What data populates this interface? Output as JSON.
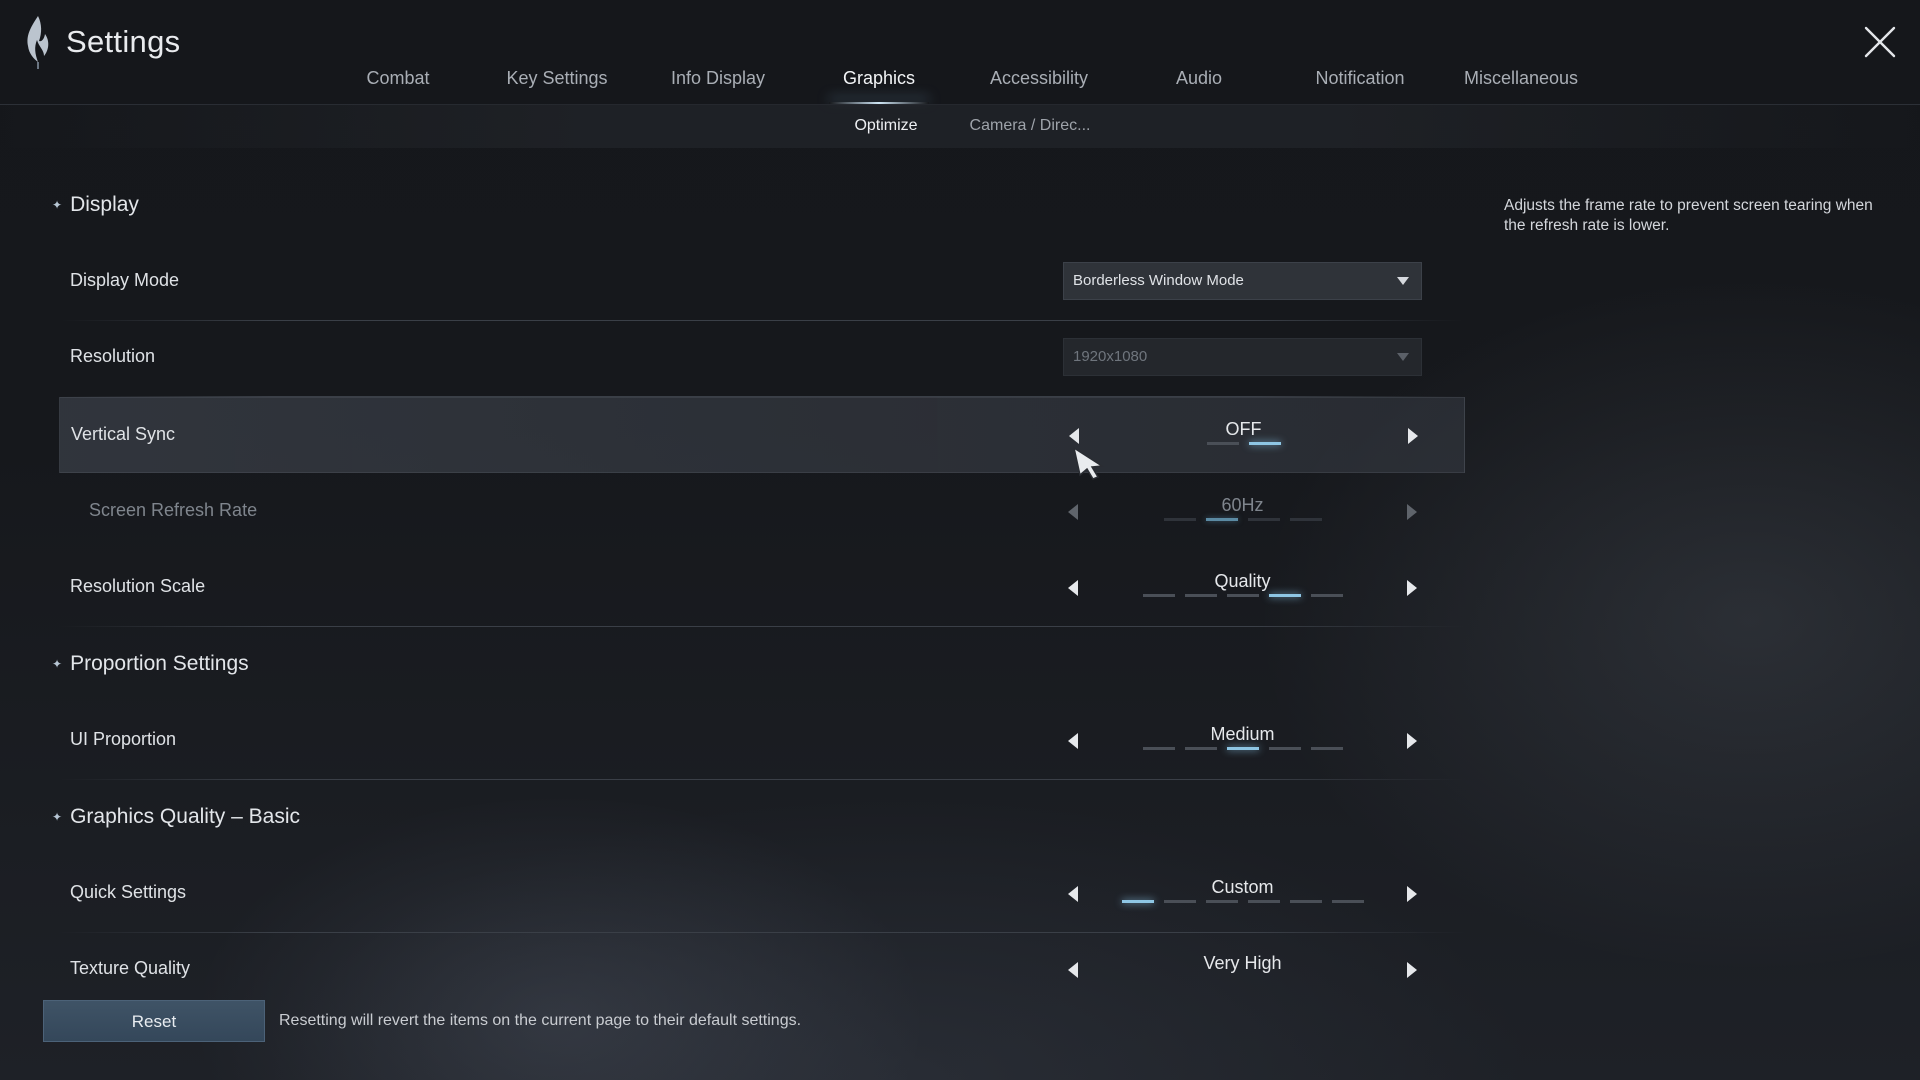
{
  "header": {
    "title": "Settings"
  },
  "tabs": [
    {
      "label": "Combat"
    },
    {
      "label": "Key Settings"
    },
    {
      "label": "Info Display"
    },
    {
      "label": "Graphics",
      "active": true
    },
    {
      "label": "Accessibility"
    },
    {
      "label": "Audio"
    },
    {
      "label": "Notification"
    },
    {
      "label": "Miscellaneous"
    }
  ],
  "subtabs": [
    {
      "label": "Optimize",
      "active": true
    },
    {
      "label": "Camera / Direc..."
    }
  ],
  "sections": {
    "display": "Display",
    "proportion": "Proportion Settings",
    "quality": "Graphics Quality – Basic"
  },
  "settings": {
    "display_mode": {
      "label": "Display Mode",
      "value": "Borderless Window Mode"
    },
    "resolution": {
      "label": "Resolution",
      "value": "1920x1080",
      "disabled": true
    },
    "vertical_sync": {
      "label": "Vertical Sync",
      "value": "OFF",
      "steps": 2,
      "selected": 2
    },
    "refresh_rate": {
      "label": "Screen Refresh Rate",
      "value": "60Hz",
      "steps": 4,
      "selected": 2,
      "disabled": true
    },
    "resolution_scale": {
      "label": "Resolution Scale",
      "value": "Quality",
      "steps": 5,
      "selected": 4
    },
    "ui_proportion": {
      "label": "UI Proportion",
      "value": "Medium",
      "steps": 5,
      "selected": 3
    },
    "quick_settings": {
      "label": "Quick Settings",
      "value": "Custom",
      "steps": 6,
      "selected": 1
    },
    "texture_quality": {
      "label": "Texture Quality",
      "value": "Very High"
    }
  },
  "description": "Adjusts the frame rate to prevent screen tearing when the refresh rate is lower.",
  "footer": {
    "reset_label": "Reset",
    "reset_note": "Resetting will revert the items on the current page to their default settings."
  },
  "icons": {
    "logo": "flame-logo-icon",
    "close": "close-icon",
    "dropdown": "chevron-down-icon",
    "prev": "arrow-left-icon",
    "next": "arrow-right-icon",
    "cursor": "mouse-cursor-icon"
  },
  "colors": {
    "accent": "#8ec6e4",
    "reset_button": "#3a4d60"
  }
}
